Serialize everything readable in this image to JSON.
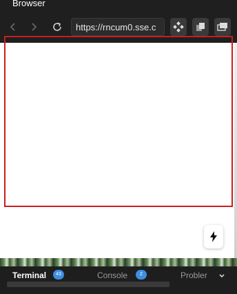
{
  "window": {
    "title": "Browser"
  },
  "toolbar": {
    "url": "https://rncum0.sse.c",
    "back_icon": "chevron-left-icon",
    "forward_icon": "chevron-right-icon",
    "reload_icon": "reload-icon",
    "extension_icon": "diamond-grid-icon",
    "copy_icon": "copy-icon",
    "windows_icon": "windows-icon"
  },
  "panel": {
    "tabs": [
      {
        "label": "Terminal",
        "badge": "43"
      },
      {
        "label": "Console",
        "badge": "2"
      },
      {
        "label": "Probler"
      }
    ],
    "collapse_icon": "chevron-down-icon"
  },
  "fab": {
    "icon": "lightning-icon"
  },
  "colors": {
    "topbar": "#1f1f1f",
    "accent_badge": "#3d8ee0",
    "red_outline": "#c81e1e"
  }
}
